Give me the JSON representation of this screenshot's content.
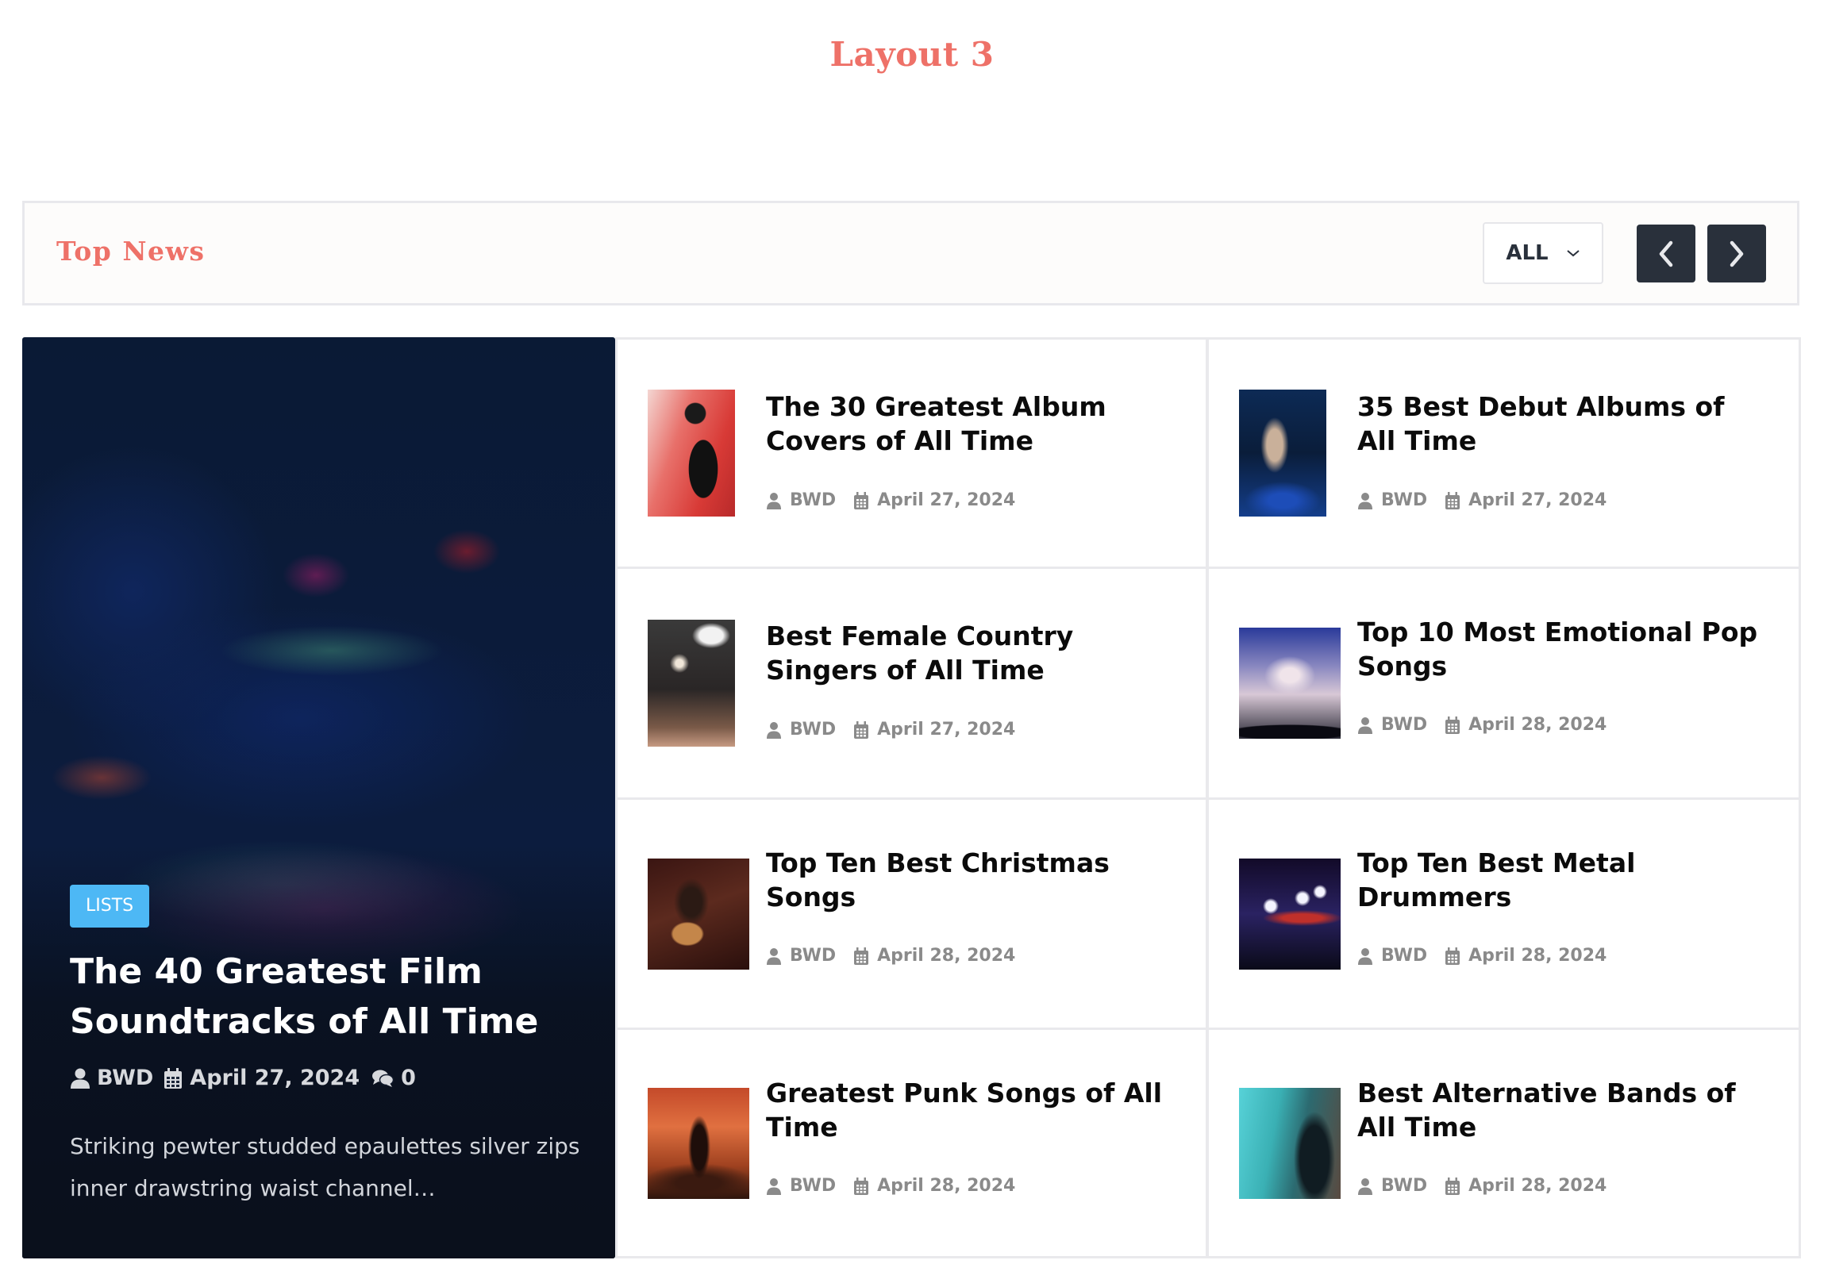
{
  "page": {
    "title": "Layout 3"
  },
  "header": {
    "title": "Top News",
    "filter": {
      "selected": "ALL",
      "icon": "chevron-down-icon"
    },
    "prev_icon": "chevron-left-icon",
    "next_icon": "chevron-right-icon"
  },
  "colors": {
    "accent": "#EE7168",
    "badge": "#4DB8F5",
    "nav_button": "#29303B",
    "meta_text": "#8A8A8A"
  },
  "feature": {
    "category": "LISTS",
    "title": "The 40 Greatest Film Soundtracks of All Time",
    "author": "BWD",
    "date": "April 27, 2024",
    "comments": "0",
    "excerpt": "Striking pewter studded epaulettes silver zips inner drawstring waist channel…"
  },
  "posts": [
    {
      "title": "The 30 Greatest Album Covers of All Time",
      "author": "BWD",
      "date": "April 27, 2024"
    },
    {
      "title": "35 Best Debut Albums of All Time",
      "author": "BWD",
      "date": "April 27, 2024"
    },
    {
      "title": "Best Female Country Singers of All Time",
      "author": "BWD",
      "date": "April 27, 2024"
    },
    {
      "title": "Top 10 Most Emotional Pop Songs",
      "author": "BWD",
      "date": "April 28, 2024"
    },
    {
      "title": "Top Ten Best Christmas Songs",
      "author": "BWD",
      "date": "April 28, 2024"
    },
    {
      "title": "Top Ten Best Metal Drummers",
      "author": "BWD",
      "date": "April 28, 2024"
    },
    {
      "title": "Greatest Punk Songs of All Time",
      "author": "BWD",
      "date": "April 28, 2024"
    },
    {
      "title": "Best Alternative Bands of All Time",
      "author": "BWD",
      "date": "April 28, 2024"
    }
  ]
}
